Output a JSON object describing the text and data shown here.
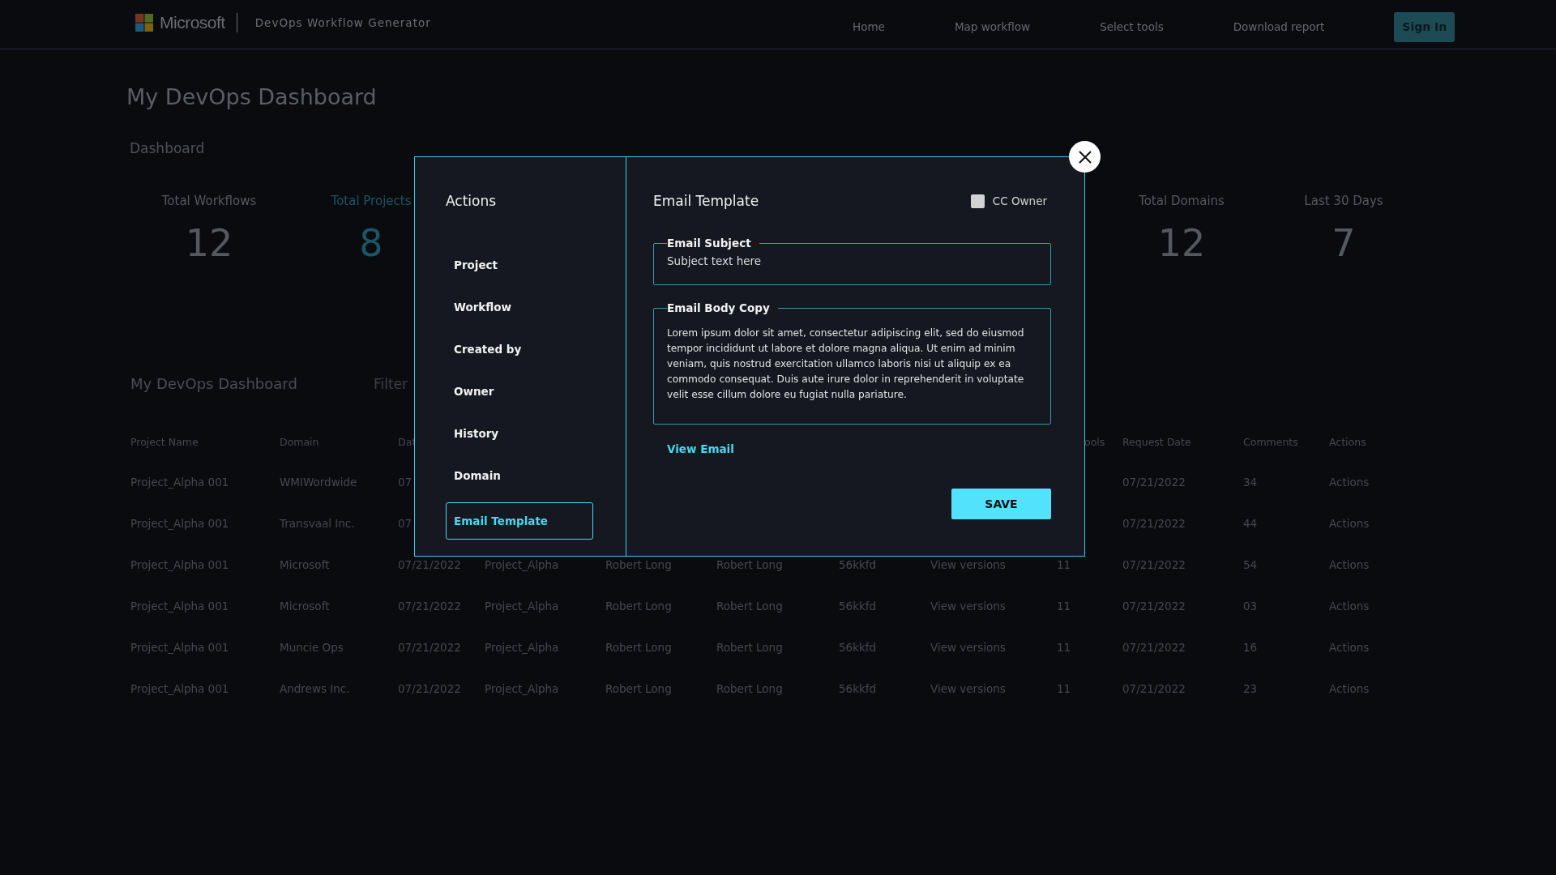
{
  "header": {
    "brand": "Microsoft",
    "app_title": "DevOps Workflow Generator",
    "nav": [
      {
        "label": "Home"
      },
      {
        "label": "Map workflow"
      },
      {
        "label": "Select tools"
      },
      {
        "label": "Download report"
      }
    ],
    "sign_in": "Sign In"
  },
  "page_title": "My DevOps Dashboard",
  "section_label": "Dashboard",
  "stats_left": [
    {
      "label": "Total Workflows",
      "value": "12",
      "highlighted": false
    },
    {
      "label": "Total Projects",
      "value": "8",
      "highlighted": true
    }
  ],
  "stats_right": [
    {
      "label": "Total Domains",
      "value": "12",
      "highlighted": false
    },
    {
      "label": "Last 30 Days",
      "value": "7",
      "highlighted": false
    }
  ],
  "table_title": "My DevOps Dashboard",
  "filter": "Filter",
  "table": {
    "columns": {
      "project_name": "Project Name",
      "domain": "Domain",
      "column_3": "Dat",
      "column_9": "ools",
      "request_date": "Request Date",
      "comments": "Comments",
      "actions": "Actions"
    },
    "rows": [
      {
        "project_name": "Project_Alpha 001",
        "domain": "WMIWordwide",
        "column_3": "07",
        "request_date": "07/21/2022",
        "comments": "34",
        "actions": "Actions"
      },
      {
        "project_name": "Project_Alpha 001",
        "domain": "Transvaal Inc.",
        "column_3": "07",
        "request_date": "07/21/2022",
        "comments": "44",
        "actions": "Actions"
      },
      {
        "project_name": "Project_Alpha 001",
        "domain": "Microsoft",
        "column_3": "07/21/2022",
        "column_4": "Project_Alpha",
        "column_5": "Robert Long",
        "column_6": "Robert Long",
        "column_7": "56kkfd",
        "column_8": "View versions",
        "column_9": "11",
        "request_date": "07/21/2022",
        "comments": "54",
        "actions": "Actions"
      },
      {
        "project_name": "Project_Alpha 001",
        "domain": "Microsoft",
        "column_3": "07/21/2022",
        "column_4": "Project_Alpha",
        "column_5": "Robert Long",
        "column_6": "Robert Long",
        "column_7": "56kkfd",
        "column_8": "View versions",
        "column_9": "11",
        "request_date": "07/21/2022",
        "comments": "03",
        "actions": "Actions"
      },
      {
        "project_name": "Project_Alpha 001",
        "domain": "Muncie Ops",
        "column_3": "07/21/2022",
        "column_4": "Project_Alpha",
        "column_5": "Robert Long",
        "column_6": "Robert Long",
        "column_7": "56kkfd",
        "column_8": "View versions",
        "column_9": "11",
        "request_date": "07/21/2022",
        "comments": "16",
        "actions": "Actions"
      },
      {
        "project_name": "Project_Alpha 001",
        "domain": "Andrews Inc.",
        "column_3": "07/21/2022",
        "column_4": "Project_Alpha",
        "column_5": "Robert Long",
        "column_6": "Robert Long",
        "column_7": "56kkfd",
        "column_8": "View versions",
        "column_9": "11",
        "request_date": "07/21/2022",
        "comments": "23",
        "actions": "Actions"
      }
    ]
  },
  "modal": {
    "menu_title": "Actions",
    "menu": [
      {
        "label": "Project",
        "selected": false
      },
      {
        "label": "Workflow",
        "selected": false
      },
      {
        "label": "Created by",
        "selected": false
      },
      {
        "label": "Owner",
        "selected": false
      },
      {
        "label": "History",
        "selected": false
      },
      {
        "label": "Domain",
        "selected": false
      },
      {
        "label": "Email Template",
        "selected": true
      }
    ],
    "title": "Email Template",
    "cc_owner": {
      "label": "CC Owner",
      "checked": false
    },
    "subject": {
      "label": "Email Subject",
      "placeholder": "Subject text here"
    },
    "body": {
      "label": "Email Body Copy",
      "value": "Lorem ipsum dolor sit amet, consectetur adipiscing elit, sed do eiusmod tempor incididunt ut labore et dolore magna aliqua. Ut enim ad minim veniam, quis nostrud exercitation ullamco laboris nisi ut aliquip ex ea commodo consequat. Duis aute irure dolor in reprehenderit in voluptate velit esse cillum dolore eu fugiat nulla pariature."
    },
    "link": "View Email",
    "save": "SAVE"
  }
}
